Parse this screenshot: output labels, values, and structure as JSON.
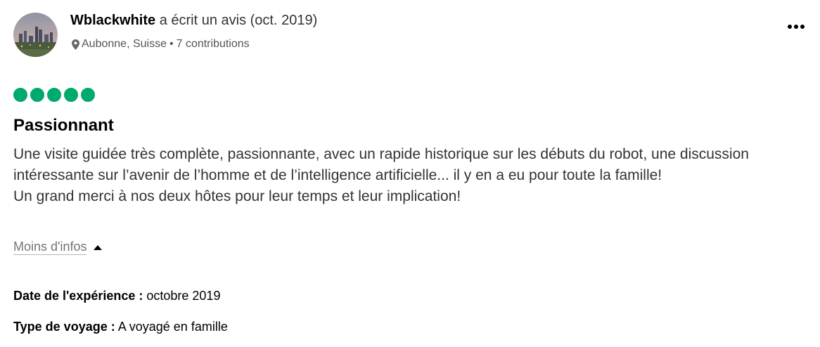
{
  "reviewer": {
    "name": "Wblackwhite",
    "action": "a écrit un avis (oct. 2019)",
    "location": "Aubonne, Suisse",
    "separator": "•",
    "contributions": "7 contributions"
  },
  "review": {
    "rating": 5,
    "rating_max": 5,
    "bubble_color": "#00aa6c",
    "title": "Passionnant",
    "body": [
      "Une visite guidée très complète, passionnante, avec un rapide historique sur les débuts du robot, une discussion intéressante sur l’avenir de l’homme et de l’intelligence artificielle... il y en a eu pour toute la famille!",
      "Un grand merci à nos deux hôtes pour leur temps et leur implication!"
    ],
    "toggle_label": "Moins d'infos"
  },
  "details": {
    "date_label": "Date de l'expérience :",
    "date_value": "octobre 2019",
    "trip_label": "Type de voyage :",
    "trip_value": "A voyagé en famille"
  },
  "icons": {
    "location": "map-pin-icon",
    "more": "more-options-icon",
    "toggle": "caret-up-icon"
  }
}
